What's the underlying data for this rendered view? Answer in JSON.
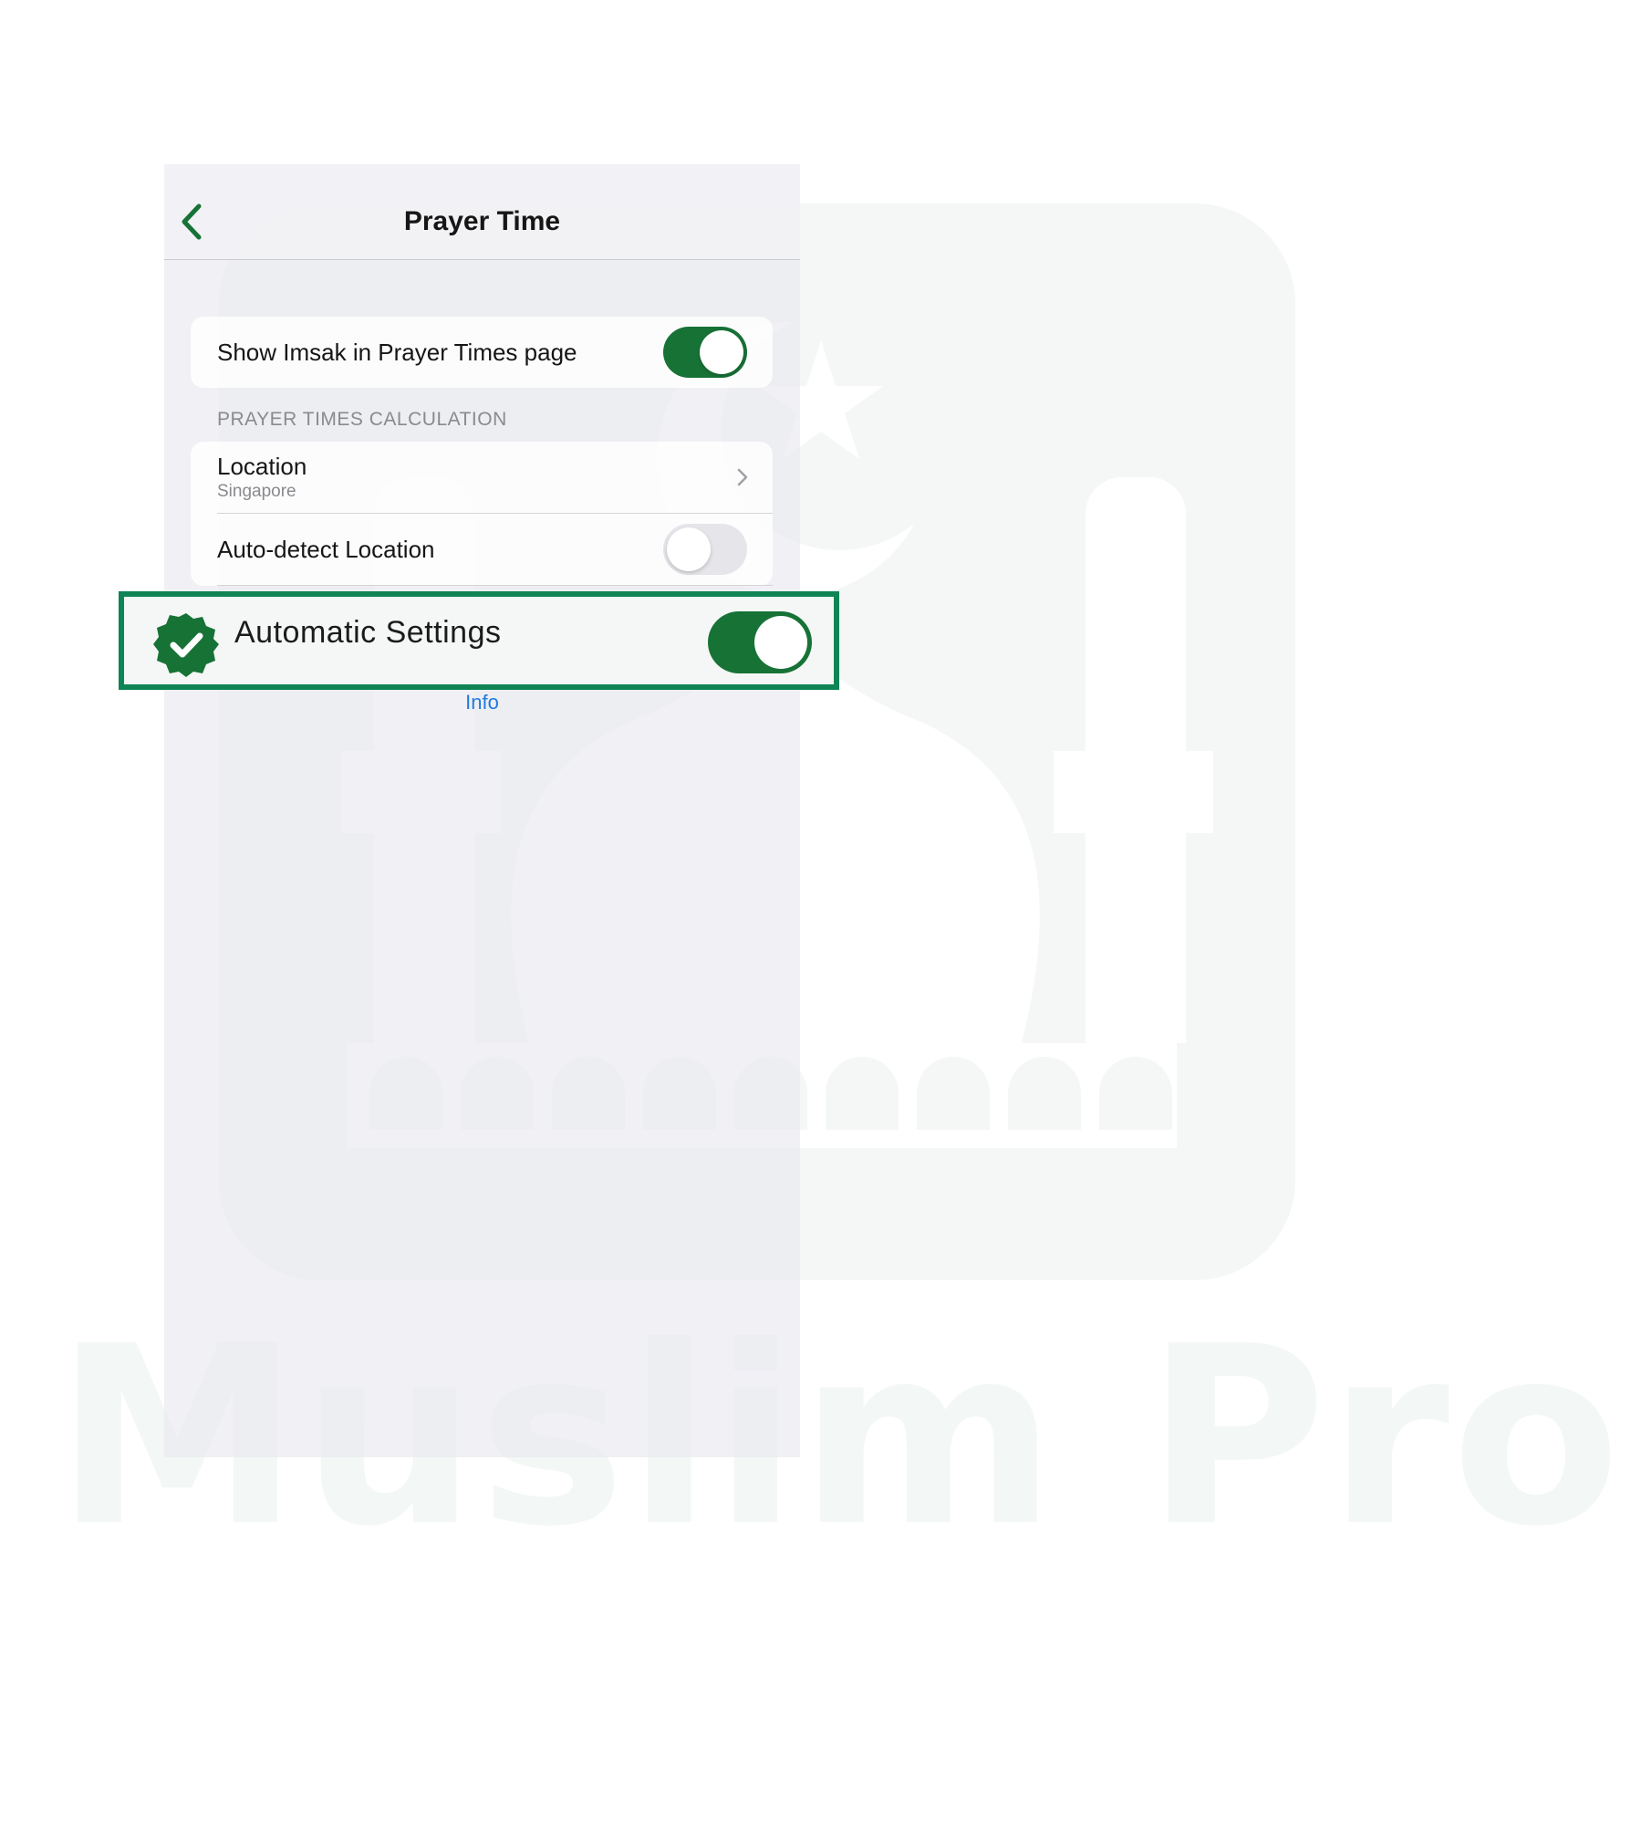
{
  "watermark": {
    "brand_text": "Muslim Pro",
    "logo_icon": "mosque-logo-icon"
  },
  "navbar": {
    "title": "Prayer Time",
    "back_icon": "chevron-left-icon"
  },
  "imsak": {
    "label": "Show Imsak in Prayer Times page",
    "toggle_on": true
  },
  "calculation": {
    "section_header": "PRAYER TIMES CALCULATION",
    "location": {
      "label": "Location",
      "value": "Singapore",
      "icon": "chevron-right-icon"
    },
    "auto_detect": {
      "label": "Auto-detect Location",
      "toggle_on": false
    }
  },
  "automatic_settings": {
    "label": "Automatic Settings",
    "toggle_on": true,
    "badge_icon": "verified-badge-icon"
  },
  "info_link": "Info",
  "colors": {
    "toggle_green": "#177236",
    "highlight_border": "#0f8455",
    "link_blue": "#1f7ae0"
  }
}
